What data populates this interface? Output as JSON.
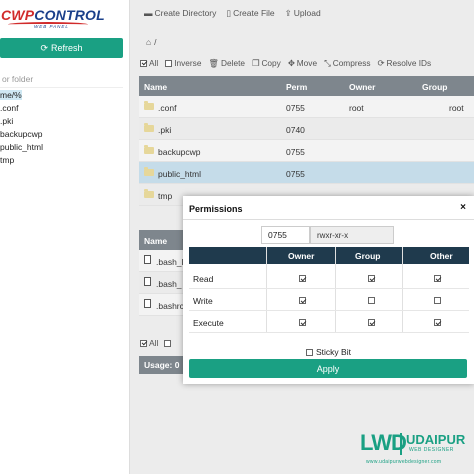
{
  "logo": {
    "part1": "CWP",
    "part2": "CONTROL",
    "sub": "WEB PANEL"
  },
  "sidebar": {
    "refresh_label": "Refresh",
    "filter_placeholder": "or folder",
    "tree": [
      "me/%",
      ".conf",
      ".pki",
      "backupcwp",
      "public_html",
      "tmp"
    ]
  },
  "toolbar": {
    "create_dir": "Create Directory",
    "create_file": "Create File",
    "upload": "Upload"
  },
  "path": {
    "sep": "/"
  },
  "actions": {
    "all": "All",
    "inverse": "Inverse",
    "delete": "Delete",
    "copy": "Copy",
    "move": "Move",
    "compress": "Compress",
    "resolve_ids": "Resolve IDs"
  },
  "table1": {
    "headers": [
      "Name",
      "Perm",
      "Owner",
      "Group"
    ],
    "rows": [
      {
        "name": ".conf",
        "perm": "0755",
        "owner": "root",
        "group": "root"
      },
      {
        "name": ".pki",
        "perm": "0740",
        "owner": "",
        "group": ""
      },
      {
        "name": "backupcwp",
        "perm": "0755",
        "owner": "",
        "group": ""
      },
      {
        "name": "public_html",
        "perm": "0755",
        "owner": "",
        "group": ""
      },
      {
        "name": "tmp",
        "perm": "",
        "owner": "",
        "group": ""
      }
    ]
  },
  "table2": {
    "header": "Name",
    "rows": [
      ".bash_l",
      ".bash_",
      ".bashrc"
    ]
  },
  "bottom": {
    "all": "All"
  },
  "usage": {
    "label": "Usage: 0"
  },
  "modal": {
    "title": "Permissions",
    "close": "×",
    "octal_value": "0755",
    "symbolic": "rwxr-xr-x",
    "columns": [
      "Owner",
      "Group",
      "Other"
    ],
    "rows": [
      {
        "label": "Read",
        "owner": true,
        "group": true,
        "other": true
      },
      {
        "label": "Write",
        "owner": true,
        "group": false,
        "other": false
      },
      {
        "label": "Execute",
        "owner": true,
        "group": true,
        "other": true
      }
    ],
    "sticky_label": "Sticky Bit",
    "sticky": false,
    "apply_label": "Apply"
  },
  "watermark": {
    "mark": "LWD",
    "name": "UDAIPUR",
    "tag": "WEB DESIGNER",
    "url": "www.udaipurwebdesigner.com"
  },
  "colors": {
    "accent": "#1aa083",
    "header": "#7e868d",
    "modal_header": "#1f3a4d",
    "selected_row": "#c5dce9"
  }
}
